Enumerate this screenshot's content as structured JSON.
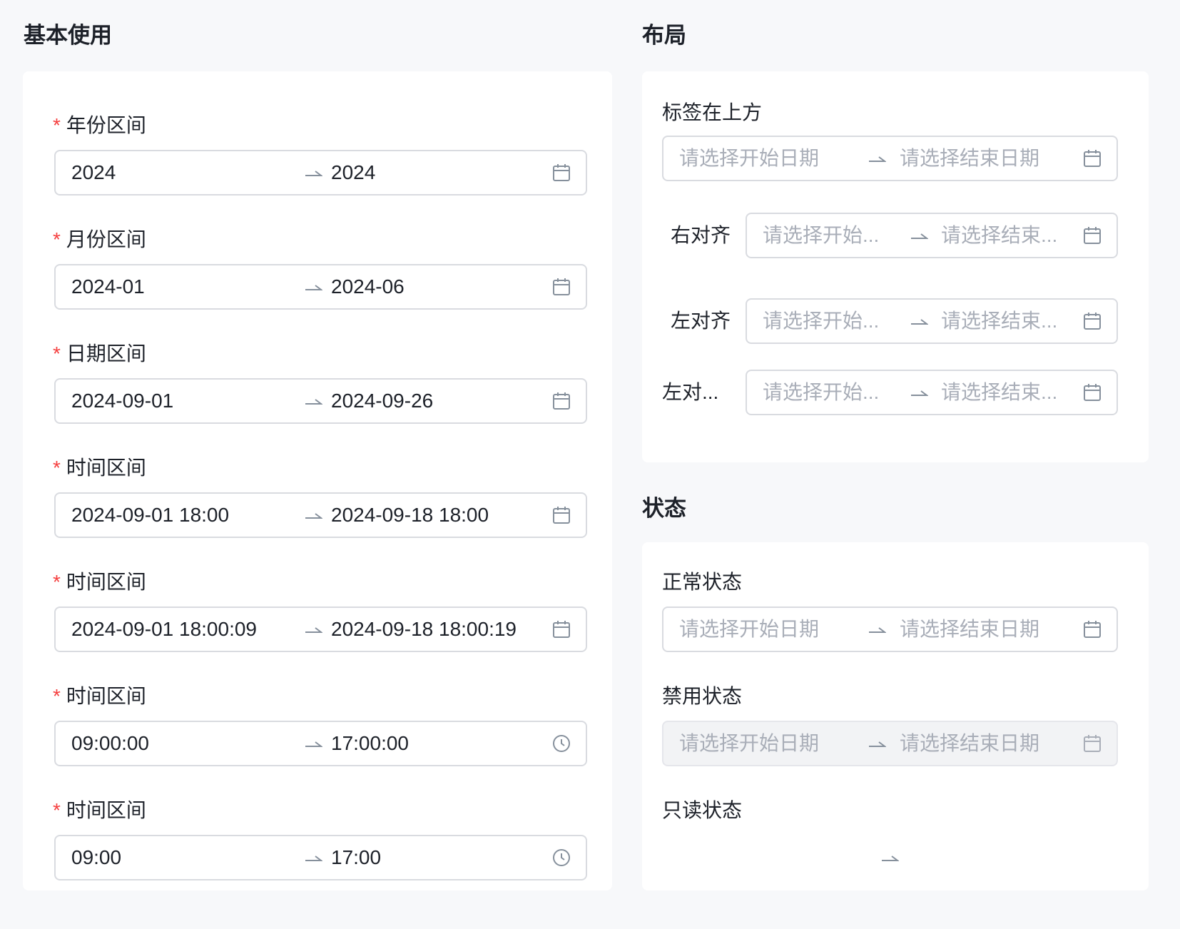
{
  "basic": {
    "title": "基本使用",
    "fields": [
      {
        "label": "年份区间",
        "required": "*",
        "start": "2024",
        "end": "2024",
        "icon": "calendar-icon"
      },
      {
        "label": "月份区间",
        "required": "*",
        "start": "2024-01",
        "end": "2024-06",
        "icon": "calendar-icon"
      },
      {
        "label": "日期区间",
        "required": "*",
        "start": "2024-09-01",
        "end": "2024-09-26",
        "icon": "calendar-icon"
      },
      {
        "label": "时间区间",
        "required": "*",
        "start": "2024-09-01 18:00",
        "end": "2024-09-18 18:00",
        "icon": "calendar-icon"
      },
      {
        "label": "时间区间",
        "required": "*",
        "start": "2024-09-01 18:00:09",
        "end": "2024-09-18 18:00:19",
        "icon": "calendar-icon"
      },
      {
        "label": "时间区间",
        "required": "*",
        "start": "09:00:00",
        "end": "17:00:00",
        "icon": "clock-icon"
      },
      {
        "label": "时间区间",
        "required": "*",
        "start": "09:00",
        "end": "17:00",
        "icon": "clock-icon"
      }
    ]
  },
  "layout": {
    "title": "布局",
    "fields": [
      {
        "label": "标签在上方",
        "start_placeholder": "请选择开始日期",
        "end_placeholder": "请选择结束日期"
      },
      {
        "label": "右对齐",
        "start_placeholder": "请选择开始...",
        "end_placeholder": "请选择结束..."
      },
      {
        "label": "左对齐",
        "start_placeholder": "请选择开始...",
        "end_placeholder": "请选择结束..."
      },
      {
        "label": "左对...",
        "start_placeholder": "请选择开始...",
        "end_placeholder": "请选择结束..."
      }
    ]
  },
  "status": {
    "title": "状态",
    "fields": [
      {
        "label": "正常状态",
        "start_placeholder": "请选择开始日期",
        "end_placeholder": "请选择结束日期"
      },
      {
        "label": "禁用状态",
        "start_placeholder": "请选择开始日期",
        "end_placeholder": "请选择结束日期"
      },
      {
        "label": "只读状态"
      }
    ]
  },
  "colors": {
    "background": "#f7f8fa",
    "card": "#ffffff",
    "required": "#f53f3f",
    "placeholder": "#a9aeb8",
    "border": "#d9dbe0",
    "disabled_bg": "#f2f3f5"
  }
}
